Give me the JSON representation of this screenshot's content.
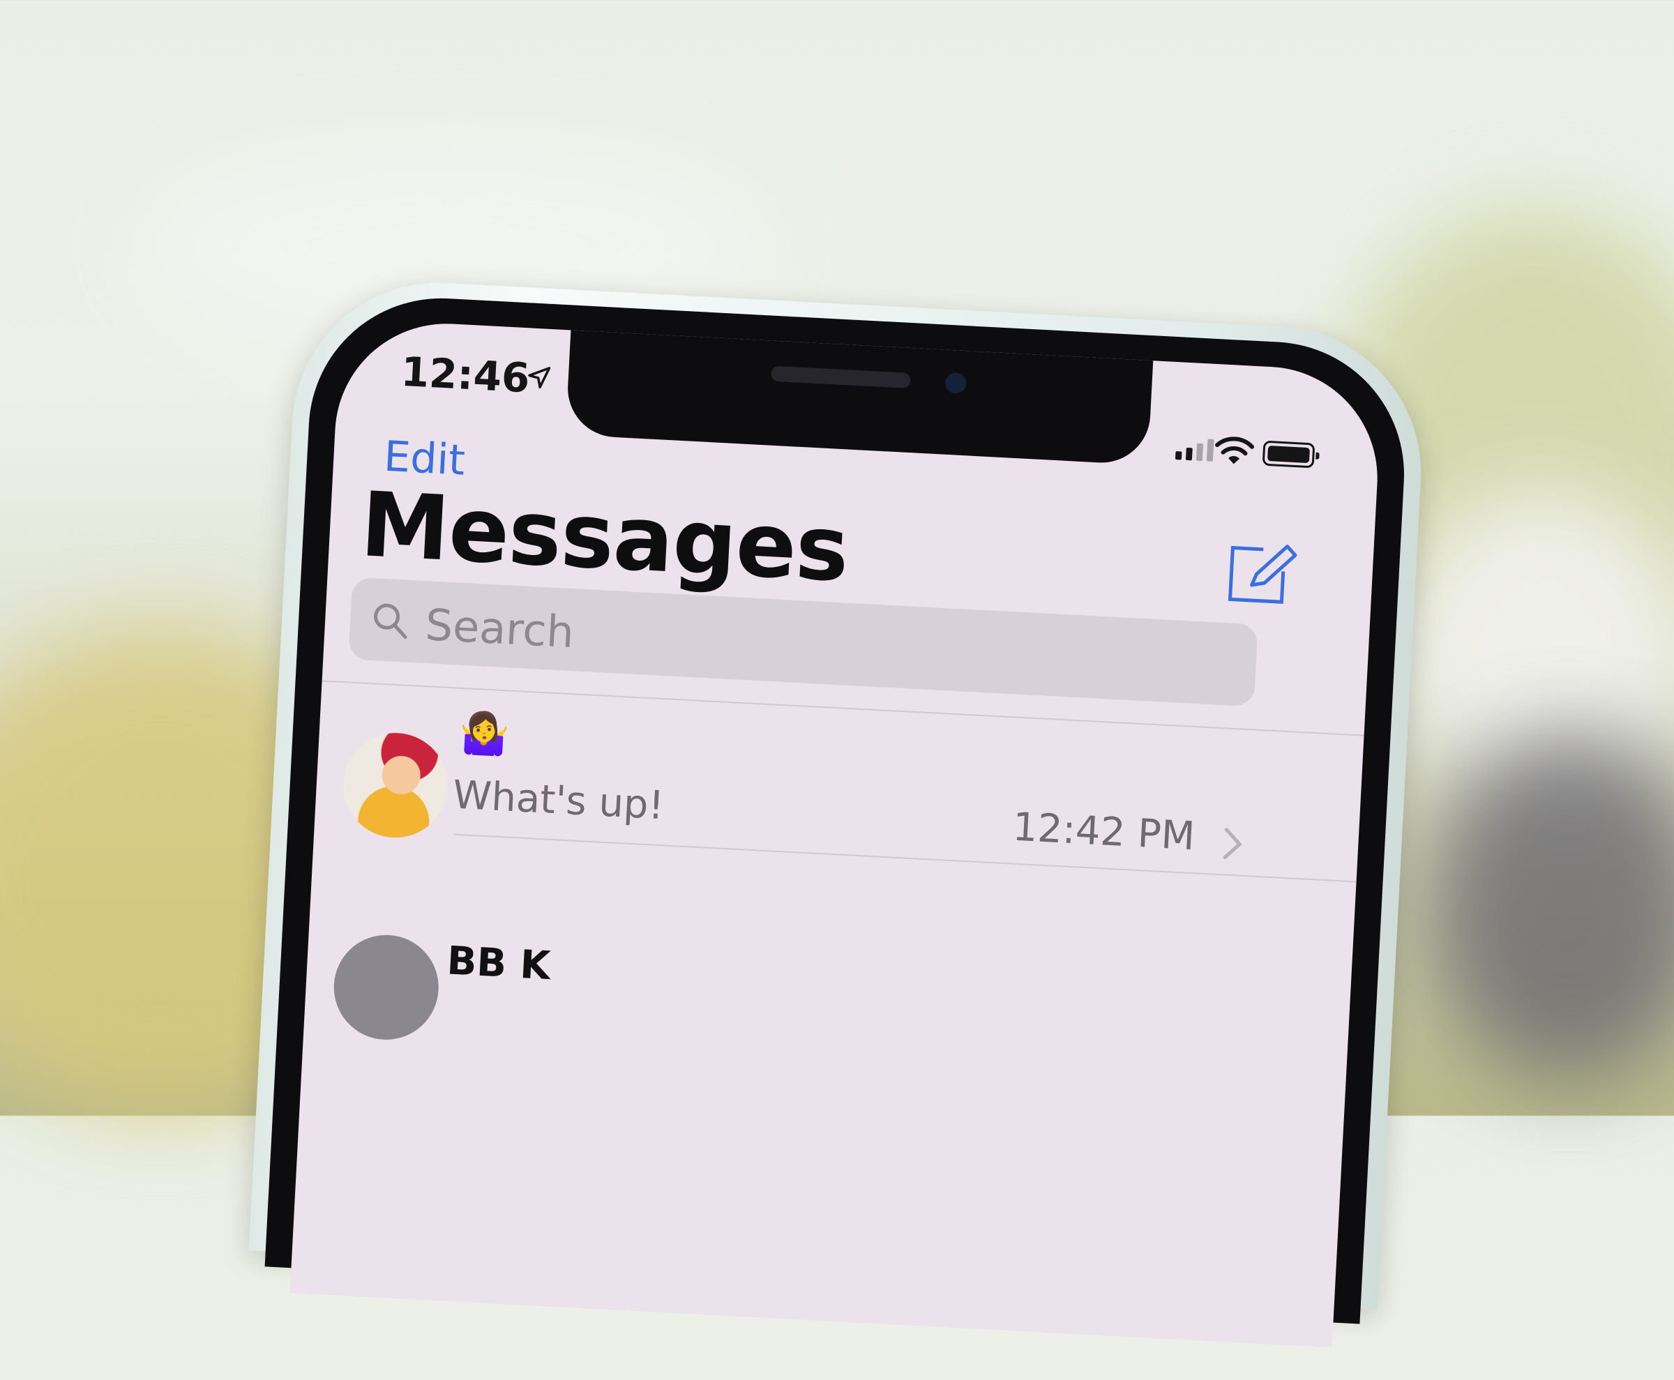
{
  "status_bar": {
    "time": "12:46"
  },
  "nav": {
    "edit_label": "Edit"
  },
  "header": {
    "title": "Messages"
  },
  "search": {
    "placeholder": "Search"
  },
  "conversations": [
    {
      "name_emoji": "🤷‍♀️",
      "preview": "What's up!",
      "time": "12:42 PM"
    },
    {
      "name": "BB K"
    }
  ],
  "colors": {
    "accent": "#3b6fe0",
    "screen_bg": "#ece2ec"
  },
  "icons": [
    "location-arrow-icon",
    "signal-icon",
    "wifi-icon",
    "battery-icon",
    "compose-icon",
    "search-icon",
    "chevron-right-icon"
  ]
}
